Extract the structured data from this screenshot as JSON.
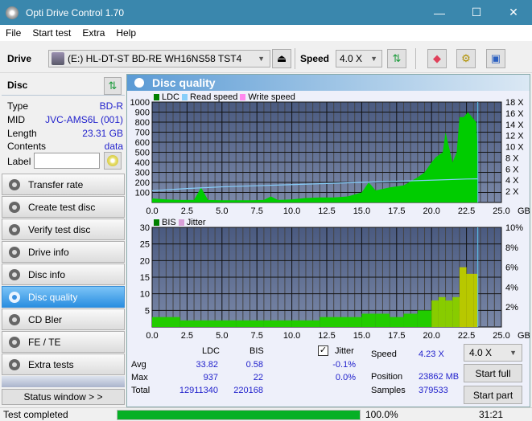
{
  "window": {
    "title": "Opti Drive Control 1.70",
    "minimize": "—",
    "maximize": "☐",
    "close": "✕"
  },
  "menu": [
    "File",
    "Start test",
    "Extra",
    "Help"
  ],
  "toolbar": {
    "drive_label": "Drive",
    "drive_value": "(E:)  HL-DT-ST BD-RE  WH16NS58 TST4",
    "speed_label": "Speed",
    "speed_value": "4.0 X",
    "icons": [
      "eject-icon",
      "refresh-icon",
      "erase-icon",
      "settings-icon",
      "save-icon"
    ]
  },
  "disc": {
    "header": "Disc",
    "rows": [
      {
        "label": "Type",
        "value": "BD-R"
      },
      {
        "label": "MID",
        "value": "JVC-AMS6L (001)"
      },
      {
        "label": "Length",
        "value": "23.31 GB"
      },
      {
        "label": "Contents",
        "value": "data"
      }
    ],
    "label_field": {
      "label": "Label",
      "value": ""
    }
  },
  "nav": [
    {
      "label": "Transfer rate",
      "active": false
    },
    {
      "label": "Create test disc",
      "active": false
    },
    {
      "label": "Verify test disc",
      "active": false
    },
    {
      "label": "Drive info",
      "active": false
    },
    {
      "label": "Disc info",
      "active": false
    },
    {
      "label": "Disc quality",
      "active": true
    },
    {
      "label": "CD Bler",
      "active": false
    },
    {
      "label": "FE / TE",
      "active": false
    },
    {
      "label": "Extra tests",
      "active": false
    }
  ],
  "status_window_label": "Status window > >",
  "panel_title": "Disc quality",
  "chart_data": [
    {
      "type": "area",
      "title": "LDC / Read speed",
      "legend": [
        {
          "name": "LDC",
          "color": "#008000"
        },
        {
          "name": "Read speed",
          "color": "#87cefa"
        },
        {
          "name": "Write speed",
          "color": "#ff88ee"
        }
      ],
      "xlabel": "GB",
      "x_ticks": [
        "0.0",
        "2.5",
        "5.0",
        "7.5",
        "10.0",
        "12.5",
        "15.0",
        "17.5",
        "20.0",
        "22.5",
        "25.0"
      ],
      "xlim": [
        0,
        25
      ],
      "y_ticks": [
        "100",
        "200",
        "300",
        "400",
        "500",
        "600",
        "700",
        "800",
        "900",
        "1000"
      ],
      "ylim": [
        0,
        1000
      ],
      "y2_ticks": [
        "2 X",
        "4 X",
        "6 X",
        "8 X",
        "10 X",
        "12 X",
        "14 X",
        "16 X",
        "18 X"
      ],
      "y2lim": [
        0,
        18
      ],
      "series": [
        {
          "name": "LDC",
          "x": [
            0,
            1,
            2,
            3,
            3.5,
            4,
            5,
            6,
            7,
            8,
            8.5,
            9,
            10,
            11,
            12,
            13,
            14,
            15,
            15.5,
            16,
            17,
            18,
            19,
            19.5,
            20,
            20.3,
            20.8,
            21,
            21.5,
            21.8,
            22,
            22.3,
            22.6,
            22.9,
            23.2,
            23.31
          ],
          "y": [
            40,
            30,
            25,
            25,
            150,
            25,
            22,
            22,
            22,
            25,
            60,
            25,
            30,
            45,
            50,
            50,
            60,
            100,
            200,
            120,
            150,
            170,
            250,
            300,
            400,
            450,
            500,
            700,
            400,
            500,
            850,
            850,
            900,
            850,
            800,
            500
          ]
        },
        {
          "name": "Read speed",
          "x": [
            0,
            2.5,
            5,
            7.5,
            10,
            12.5,
            15,
            17.5,
            20,
            22.5,
            23.31
          ],
          "y": [
            2.1,
            2.5,
            2.8,
            3.0,
            3.2,
            3.4,
            3.6,
            3.8,
            4.0,
            4.2,
            4.23
          ]
        }
      ]
    },
    {
      "type": "bar",
      "title": "BIS / Jitter",
      "legend": [
        {
          "name": "BIS",
          "color": "#008000"
        },
        {
          "name": "Jitter",
          "color": "#d8a0d8"
        }
      ],
      "xlabel": "GB",
      "x_ticks": [
        "0.0",
        "2.5",
        "5.0",
        "7.5",
        "10.0",
        "12.5",
        "15.0",
        "17.5",
        "20.0",
        "22.5",
        "25.0"
      ],
      "xlim": [
        0,
        25
      ],
      "y_ticks": [
        "5",
        "10",
        "15",
        "20",
        "25",
        "30"
      ],
      "ylim": [
        0,
        30
      ],
      "y2_ticks": [
        "2%",
        "4%",
        "6%",
        "8%",
        "10%"
      ],
      "y2lim": [
        0,
        10
      ],
      "series": [
        {
          "name": "BIS",
          "x": [
            0,
            2,
            4,
            6,
            8,
            10,
            12,
            14,
            15,
            16,
            17,
            18,
            19,
            20,
            20.5,
            21,
            21.5,
            22,
            22.5,
            23,
            23.31
          ],
          "y": [
            3,
            2,
            2,
            2,
            2,
            2,
            3,
            3,
            4,
            4,
            3,
            4,
            5,
            8,
            9,
            8,
            9,
            18,
            16,
            16,
            14
          ]
        }
      ]
    }
  ],
  "stats": {
    "col_ldc": "LDC",
    "col_bis": "BIS",
    "rows": [
      {
        "label": "Avg",
        "ldc": "33.82",
        "bis": "0.58",
        "jitter": "-0.1%"
      },
      {
        "label": "Max",
        "ldc": "937",
        "bis": "22",
        "jitter": "0.0%"
      },
      {
        "label": "Total",
        "ldc": "12911340",
        "bis": "220168"
      }
    ],
    "jitter_label": "Jitter",
    "jitter_checked": true,
    "speed_label": "Speed",
    "speed_value": "4.23 X",
    "position_label": "Position",
    "position_value": "23862 MB",
    "samples_label": "Samples",
    "samples_value": "379533",
    "speed_select": "4.0 X",
    "start_full": "Start full",
    "start_part": "Start part"
  },
  "status": {
    "text": "Test completed",
    "progress": 100.0,
    "progress_text": "100.0%",
    "time": "31:21"
  }
}
